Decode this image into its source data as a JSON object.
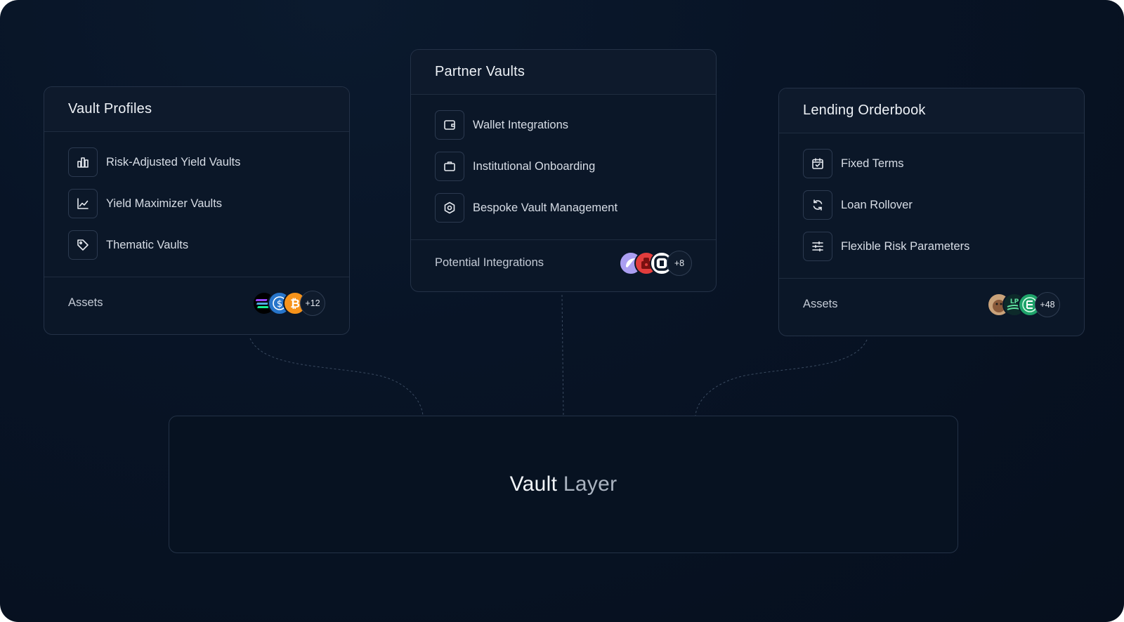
{
  "cards": {
    "vault_profiles": {
      "title": "Vault Profiles",
      "items": [
        {
          "label": "Risk-Adjusted Yield Vaults",
          "icon": "bar-chart-icon"
        },
        {
          "label": "Yield Maximizer Vaults",
          "icon": "line-chart-icon"
        },
        {
          "label": "Thematic Vaults",
          "icon": "tag-icon"
        }
      ],
      "footer_label": "Assets",
      "avatars": [
        "solana-token-icon",
        "usdc-token-icon",
        "bitcoin-token-icon"
      ],
      "extra_count": "+12"
    },
    "partner_vaults": {
      "title": "Partner Vaults",
      "items": [
        {
          "label": "Wallet Integrations",
          "icon": "wallet-icon"
        },
        {
          "label": "Institutional Onboarding",
          "icon": "briefcase-icon"
        },
        {
          "label": "Bespoke Vault Management",
          "icon": "hexagon-icon"
        }
      ],
      "footer_label": "Potential Integrations",
      "avatars": [
        "phantom-logo-icon",
        "robot-logo-icon",
        "circle-logo-icon"
      ],
      "extra_count": "+8"
    },
    "lending_orderbook": {
      "title": "Lending Orderbook",
      "items": [
        {
          "label": "Fixed Terms",
          "icon": "calendar-check-icon"
        },
        {
          "label": "Loan Rollover",
          "icon": "refresh-icon"
        },
        {
          "label": "Flexible Risk Parameters",
          "icon": "sliders-icon"
        }
      ],
      "footer_label": "Assets",
      "avatars": [
        "bonk-token-icon",
        "lp-token-icon",
        "green-token-icon"
      ],
      "extra_count": "+48"
    }
  },
  "layer": {
    "word1": "Vault",
    "word2": "Layer"
  },
  "colors": {
    "background": "#060f1d",
    "card": "#0b1728",
    "border": "#243247",
    "text": "#e6eaf0"
  }
}
